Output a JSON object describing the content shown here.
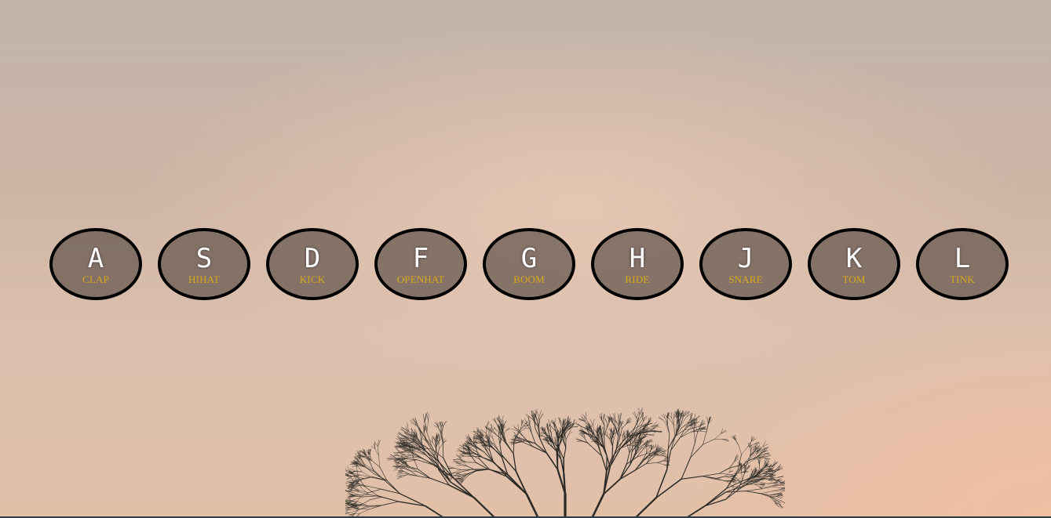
{
  "keys": [
    {
      "letter": "A",
      "sound": "CLAP"
    },
    {
      "letter": "S",
      "sound": "HIHAT"
    },
    {
      "letter": "D",
      "sound": "KICK"
    },
    {
      "letter": "F",
      "sound": "OPENHAT"
    },
    {
      "letter": "G",
      "sound": "BOOM"
    },
    {
      "letter": "H",
      "sound": "RIDE"
    },
    {
      "letter": "J",
      "sound": "SNARE"
    },
    {
      "letter": "K",
      "sound": "TOM"
    },
    {
      "letter": "L",
      "sound": "TINK"
    }
  ],
  "colors": {
    "key_bg": "#6c5c54",
    "key_border": "#000000",
    "letter": "#ffffff",
    "sound": "#d7a919"
  },
  "background": {
    "scene": "bare-tree-against-sunset-sky"
  }
}
